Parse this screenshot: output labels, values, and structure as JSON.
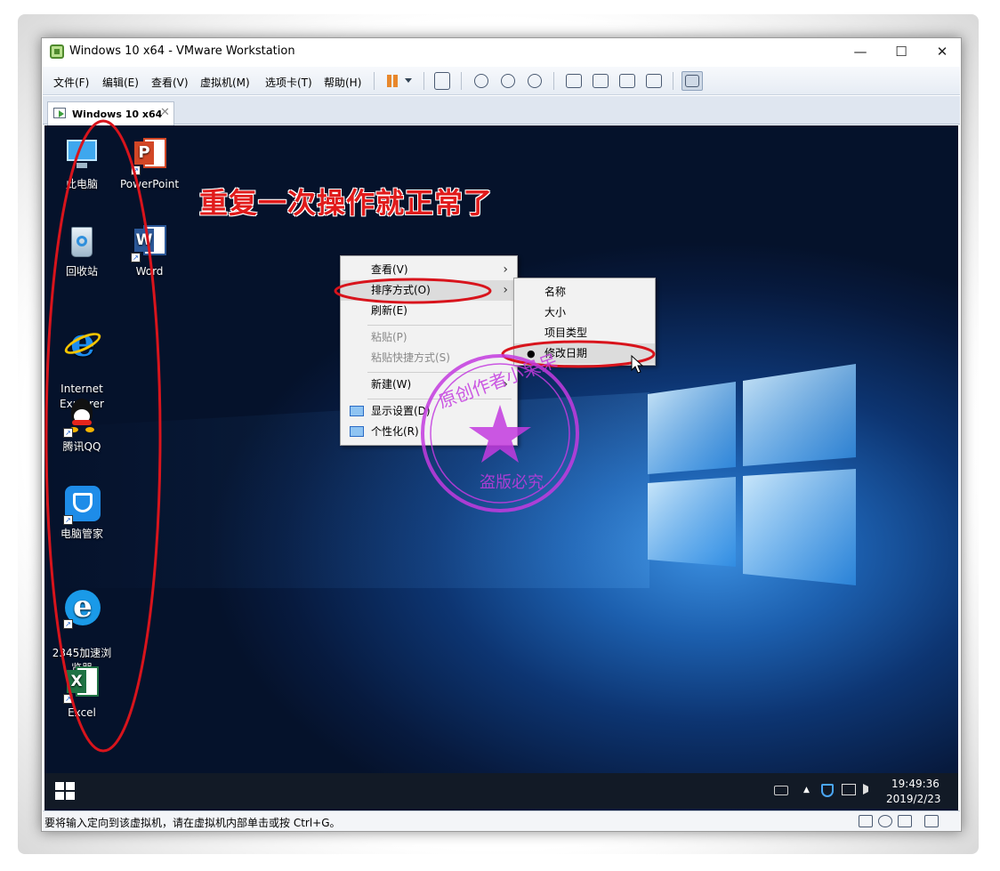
{
  "window": {
    "title": "Windows 10 x64 - VMware Workstation",
    "controls": {
      "minimize": "—",
      "maximize": "☐",
      "close": "✕"
    }
  },
  "menubar": {
    "items": [
      "文件(F)",
      "编辑(E)",
      "查看(V)",
      "虚拟机(M)",
      "选项卡(T)",
      "帮助(H)"
    ]
  },
  "tab": {
    "label": "Windows 10 x64",
    "close": "✕"
  },
  "desktop": {
    "icons": [
      {
        "label": "此电脑",
        "icon": "this-pc-icon"
      },
      {
        "label": "PowerPoint",
        "icon": "powerpoint-icon"
      },
      {
        "label": "回收站",
        "icon": "recycle-bin-icon"
      },
      {
        "label": "Word",
        "icon": "word-icon"
      },
      {
        "label": "Internet\nExplorer",
        "icon": "internet-explorer-icon"
      },
      {
        "label": "腾讯QQ",
        "icon": "qq-icon"
      },
      {
        "label": "电脑管家",
        "icon": "pc-manager-icon"
      },
      {
        "label": "2345加速浏\n览器",
        "icon": "2345-browser-icon"
      },
      {
        "label": "Excel",
        "icon": "excel-icon"
      }
    ],
    "glyphs": {
      "ppt": "P",
      "word": "W",
      "excel": "X",
      "ie": "e",
      "shortcut": "↗"
    }
  },
  "annotation": {
    "headline": "重复一次操作就正常了",
    "headline_color": "#e11b1b",
    "highlight_color": "#d8141c"
  },
  "context_menu": {
    "items": [
      {
        "label": "查看(V)",
        "submenu": true,
        "disabled": false
      },
      {
        "label": "排序方式(O)",
        "submenu": true,
        "disabled": false
      },
      {
        "label": "刷新(E)",
        "submenu": false,
        "disabled": false
      },
      {
        "label": "粘贴(P)",
        "submenu": false,
        "disabled": true
      },
      {
        "label": "粘贴快捷方式(S)",
        "submenu": false,
        "disabled": true
      },
      {
        "label": "新建(W)",
        "submenu": true,
        "disabled": false
      },
      {
        "label": "显示设置(D)",
        "submenu": false,
        "disabled": false
      },
      {
        "label": "个性化(R)",
        "submenu": false,
        "disabled": false
      }
    ],
    "arrow": "›"
  },
  "sort_submenu": {
    "items": [
      "名称",
      "大小",
      "项目类型",
      "修改日期"
    ],
    "selected": "修改日期",
    "bullet": "●"
  },
  "watermark": {
    "text_top": "原创作者小呆呆",
    "text_bottom": "盗版必究",
    "color": "#c43be0"
  },
  "taskbar": {
    "time": "19:49:36",
    "date": "2019/2/23",
    "tray_up": "▲"
  },
  "statusbar": {
    "text": "要将输入定向到该虚拟机，请在虚拟机内部单击或按 Ctrl+G。"
  }
}
